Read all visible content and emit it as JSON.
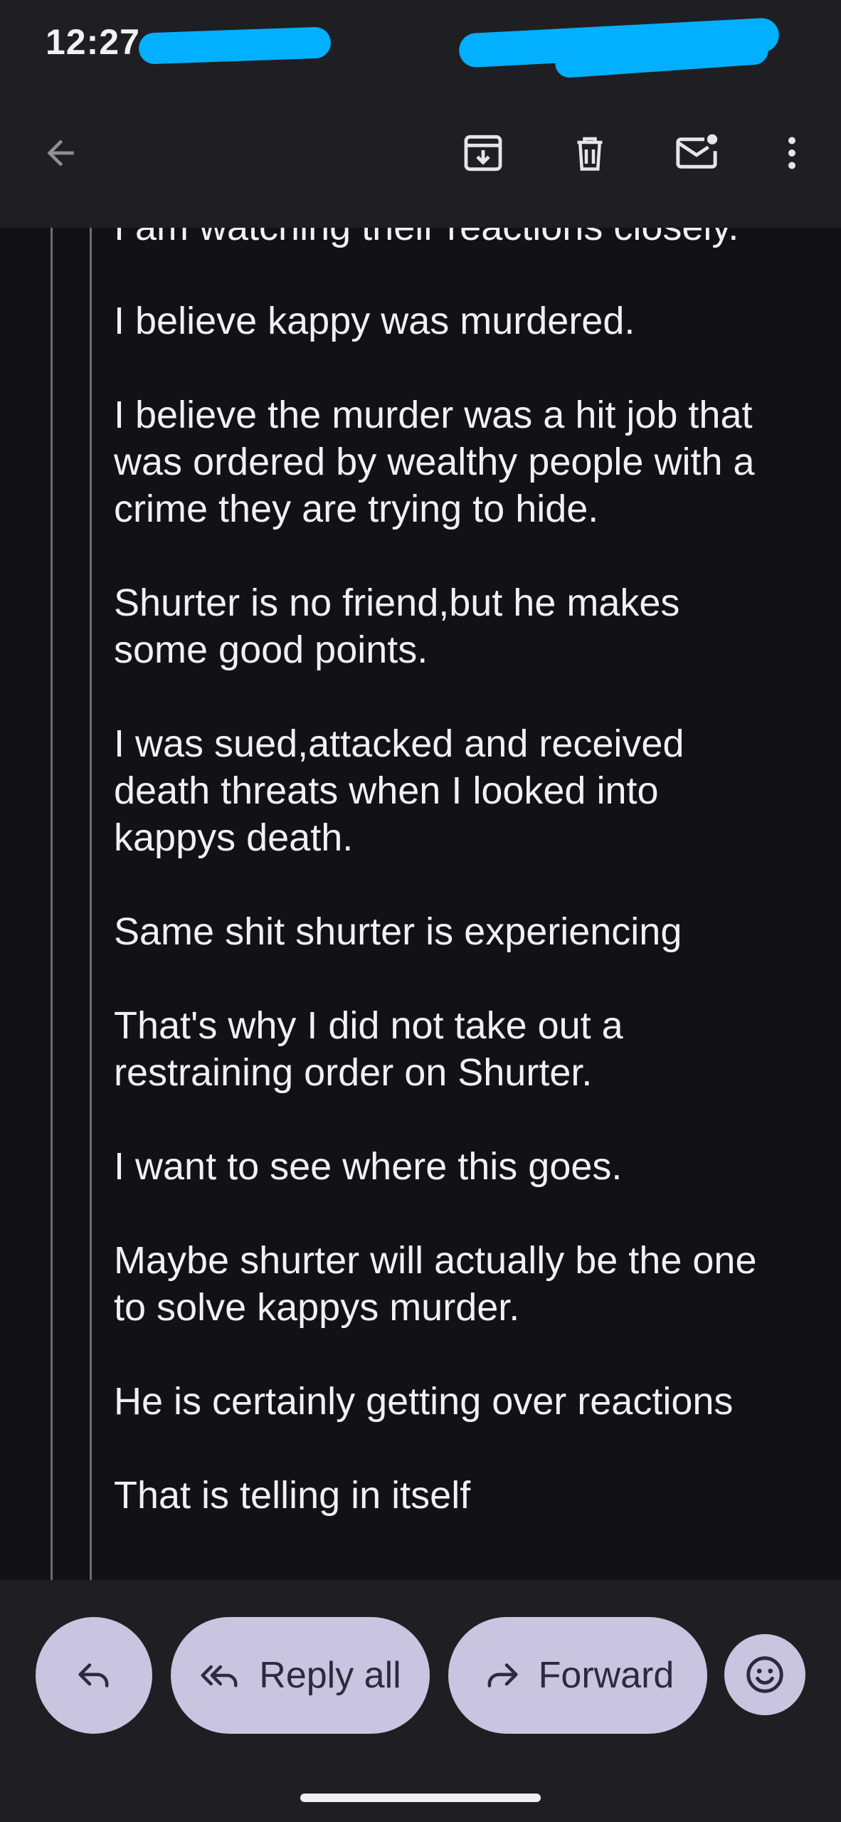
{
  "status_bar": {
    "time": "12:27"
  },
  "toolbar": {
    "back_icon": "arrow-left-icon",
    "archive_icon": "archive-icon",
    "delete_icon": "trash-icon",
    "mark_unread_icon": "mail-unread-icon",
    "more_icon": "more-vert-icon"
  },
  "email": {
    "paragraphs": [
      [
        "I am watching their reactions closely."
      ],
      [
        "I believe kappy was murdered."
      ],
      [
        "I believe the murder was a hit job that",
        "was ordered by wealthy people with a",
        "crime they are trying to hide."
      ],
      [
        "Shurter is no friend,but he makes",
        "some good points."
      ],
      [
        "I was sued,attacked and received",
        "death threats when I looked into",
        "kappys death."
      ],
      [
        "Same shit shurter is experiencing"
      ],
      [
        "That's why I did not take out a",
        "restraining order on Shurter."
      ],
      [
        "I want to see where this goes."
      ],
      [
        "Maybe shurter will actually be the one",
        "to solve kappys murder."
      ],
      [
        "He is certainly getting over reactions"
      ],
      [
        "That is telling in itself"
      ]
    ]
  },
  "actions": {
    "reply_icon": "reply-icon",
    "reply_all_label": "Reply all",
    "reply_all_icon": "reply-all-icon",
    "forward_label": "Forward",
    "forward_icon": "forward-icon",
    "emoji_icon": "emoji-reaction-icon"
  },
  "colors": {
    "background": "#111116",
    "bars": "#1f1f23",
    "pill": "#c9c4e0",
    "pill_text": "#2d2a3e",
    "redaction": "#03b0ff"
  }
}
